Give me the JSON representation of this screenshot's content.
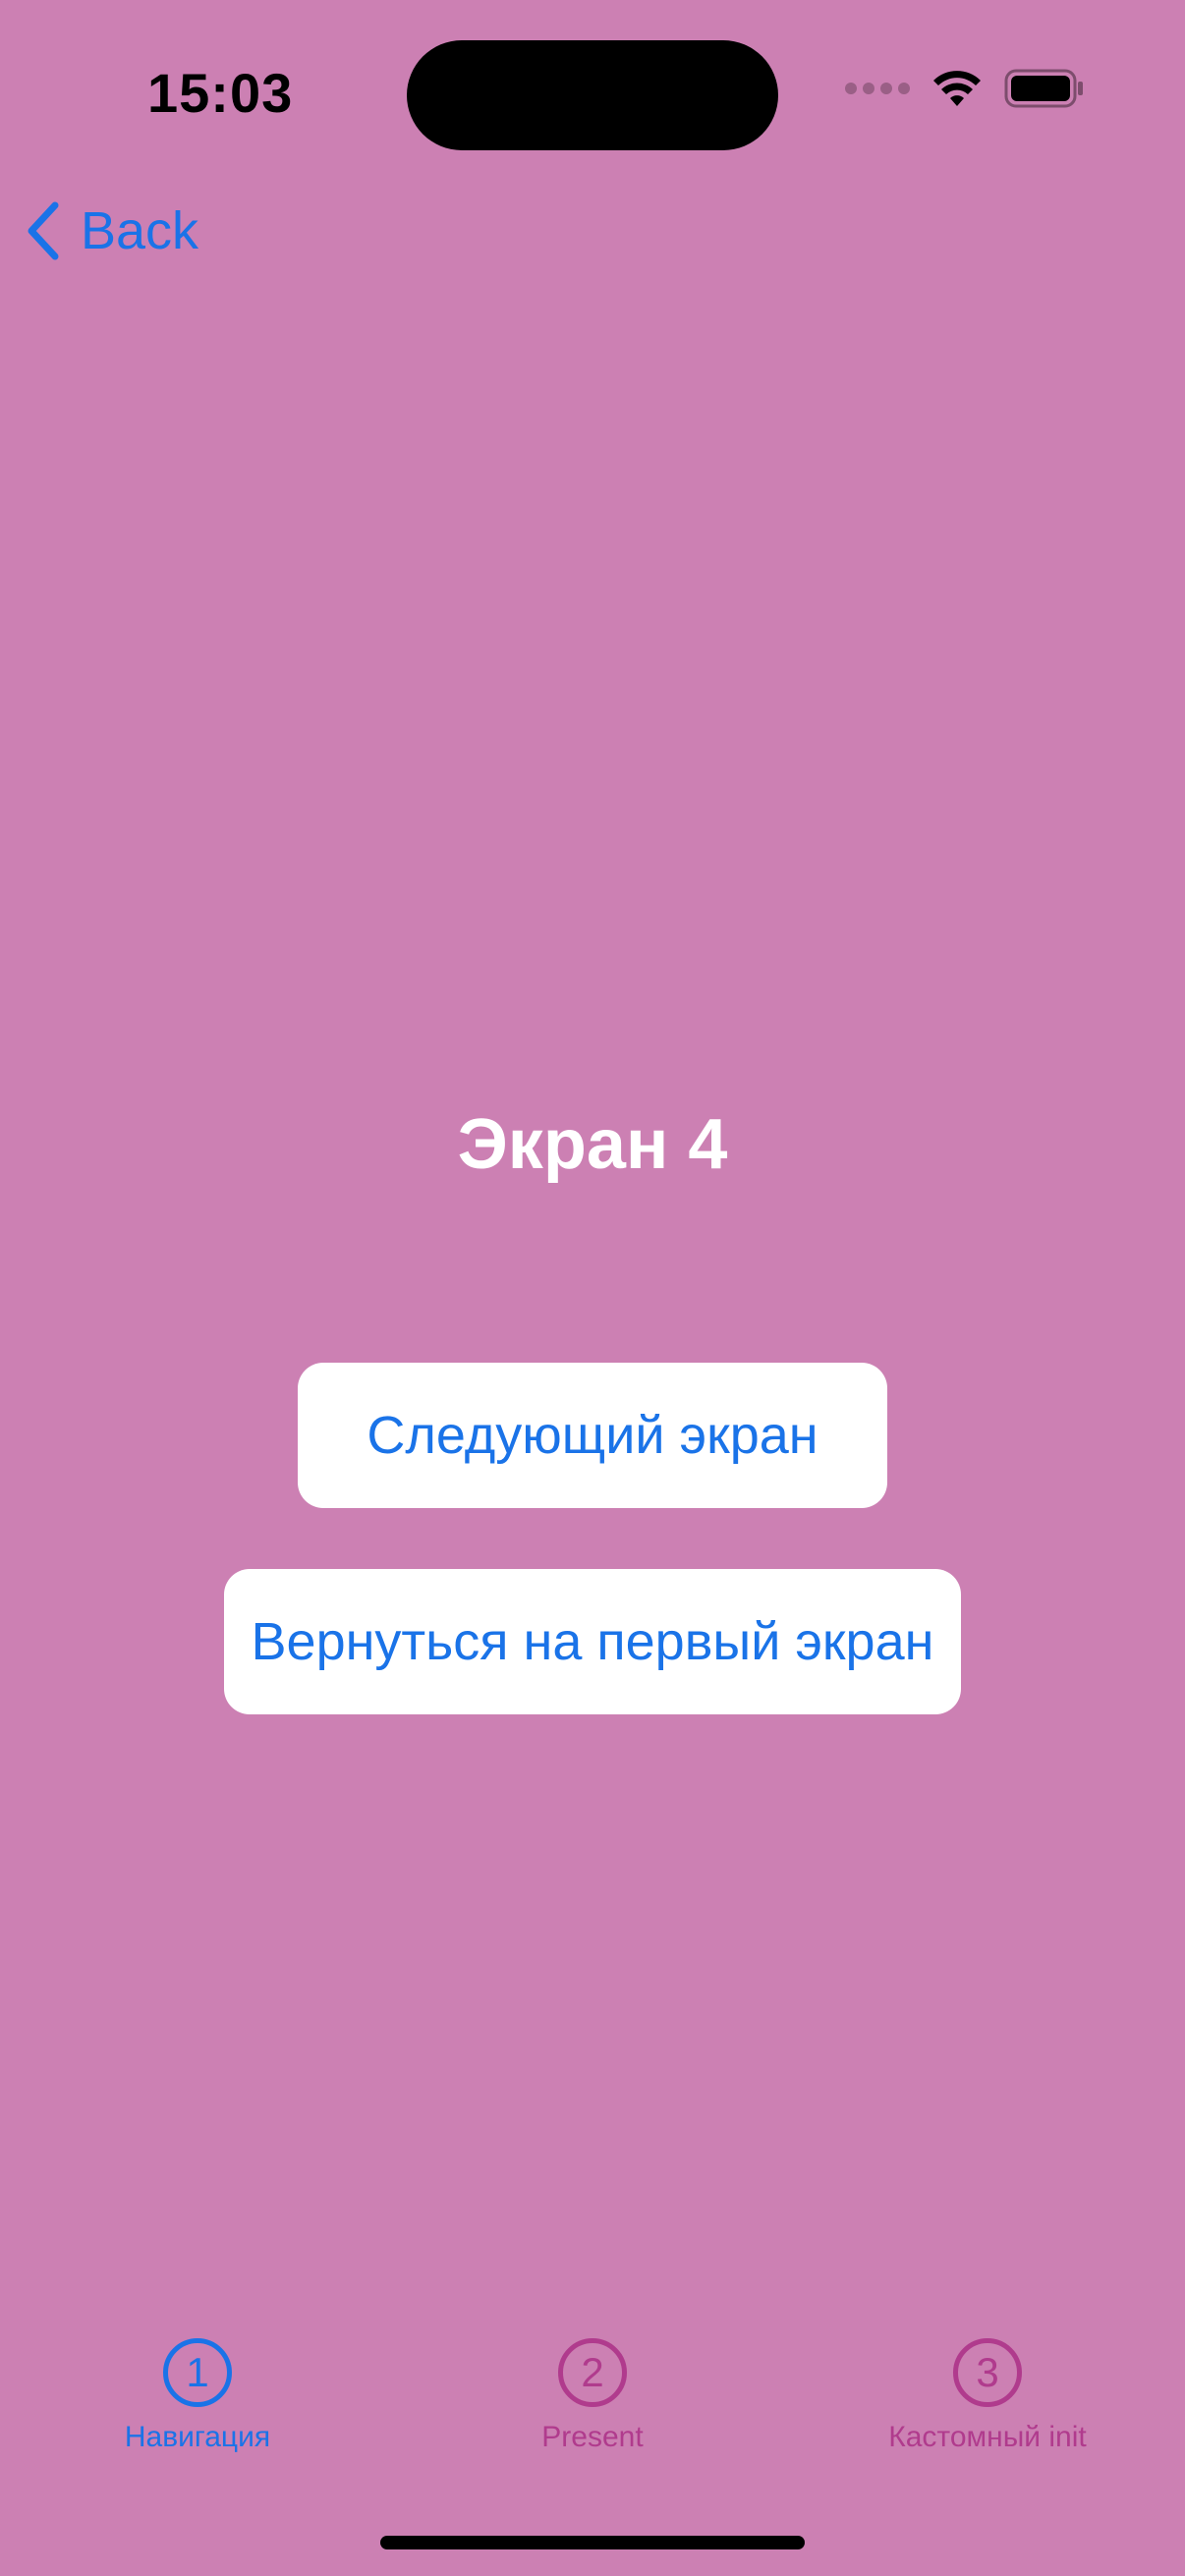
{
  "status_bar": {
    "time": "15:03"
  },
  "nav": {
    "back_label": "Back"
  },
  "main": {
    "title": "Экран 4",
    "next_button_label": "Следующий экран",
    "first_button_label": "Вернуться на первый экран"
  },
  "tabbar": {
    "tabs": [
      {
        "number": "1",
        "label": "Навигация",
        "active": true
      },
      {
        "number": "2",
        "label": "Present",
        "active": false
      },
      {
        "number": "3",
        "label": "Кастомный init",
        "active": false
      }
    ]
  },
  "colors": {
    "background": "#cc80b3",
    "accent": "#1a73e8",
    "inactive_tab": "#b03b8d",
    "title": "#ffffff",
    "button_background": "#ffffff"
  }
}
